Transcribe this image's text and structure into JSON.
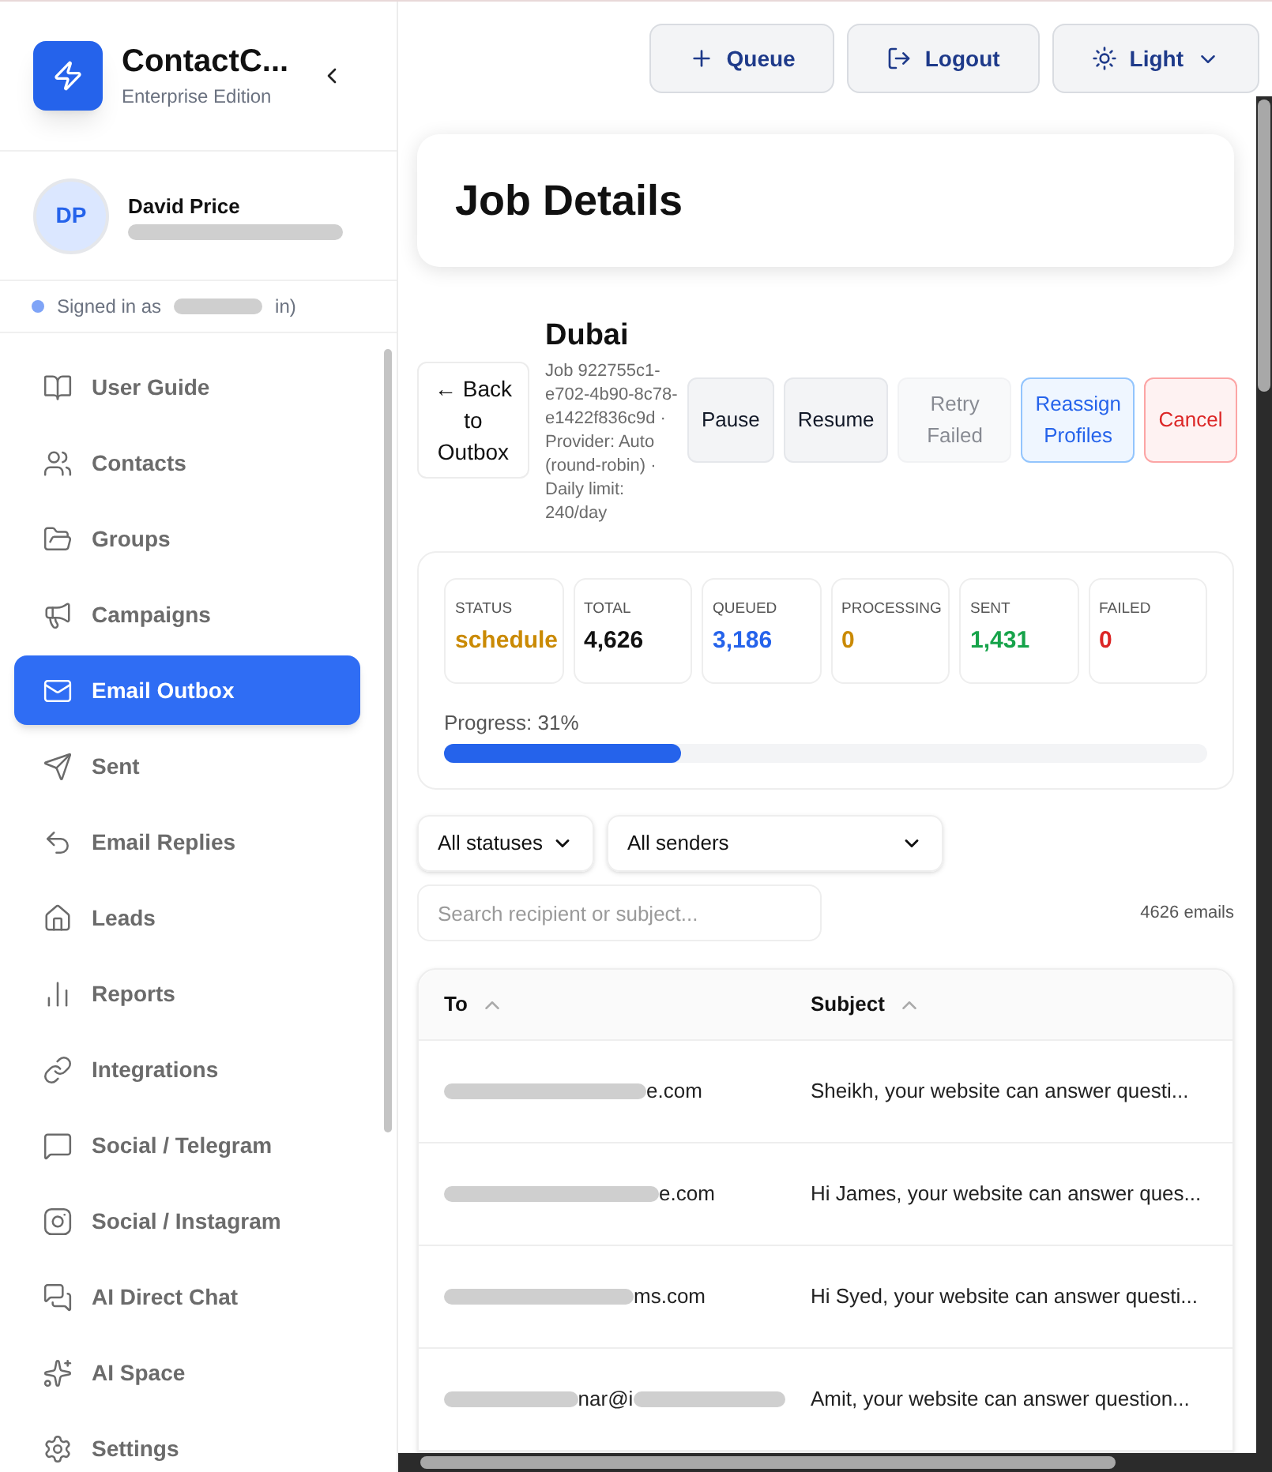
{
  "brand": {
    "name": "ContactC...",
    "edition": "Enterprise Edition"
  },
  "user": {
    "initials": "DP",
    "name": "David Price"
  },
  "signed_in": {
    "prefix": "Signed in as",
    "suffix": "in)"
  },
  "nav": [
    {
      "label": "User Guide",
      "selected": false
    },
    {
      "label": "Contacts",
      "selected": false
    },
    {
      "label": "Groups",
      "selected": false
    },
    {
      "label": "Campaigns",
      "selected": false
    },
    {
      "label": "Email Outbox",
      "selected": true
    },
    {
      "label": "Sent",
      "selected": false
    },
    {
      "label": "Email Replies",
      "selected": false
    },
    {
      "label": "Leads",
      "selected": false
    },
    {
      "label": "Reports",
      "selected": false
    },
    {
      "label": "Integrations",
      "selected": false
    },
    {
      "label": "Social / Telegram",
      "selected": false
    },
    {
      "label": "Social / Instagram",
      "selected": false
    },
    {
      "label": "AI Direct Chat",
      "selected": false
    },
    {
      "label": "AI Space",
      "selected": false
    },
    {
      "label": "Settings",
      "selected": false
    }
  ],
  "topbar": {
    "buttons": [
      {
        "label": "Queue",
        "kind": "queue"
      },
      {
        "label": "Logout",
        "kind": "logout"
      },
      {
        "label": "Light",
        "kind": "theme"
      }
    ]
  },
  "page_title": "Job Details",
  "job": {
    "back": "← Back to Outbox",
    "name": "Dubai",
    "meta": "Job 922755c1-e702-4b90-8c78-e1422f836c9d · Provider: Auto (round-robin) · Daily limit: 240/day",
    "actions": [
      {
        "label": "Pause",
        "kind": "neutral",
        "disabled": false
      },
      {
        "label": "Resume",
        "kind": "neutral",
        "disabled": false
      },
      {
        "label": "Retry Failed",
        "kind": "neutral",
        "disabled": true
      },
      {
        "label": "Reassign Profiles",
        "kind": "primary",
        "disabled": false
      },
      {
        "label": "Cancel",
        "kind": "danger",
        "disabled": false
      }
    ]
  },
  "stats": [
    {
      "label": "STATUS",
      "value": "schedule",
      "color": "#ca8a04"
    },
    {
      "label": "TOTAL",
      "value": "4,626",
      "color": "#111111"
    },
    {
      "label": "QUEUED",
      "value": "3,186",
      "color": "#2563eb"
    },
    {
      "label": "PROCESSING",
      "value": "0",
      "color": "#ca8a04"
    },
    {
      "label": "SENT",
      "value": "1,431",
      "color": "#16a34a"
    },
    {
      "label": "FAILED",
      "value": "0",
      "color": "#dc2626"
    }
  ],
  "progress": {
    "label": "Progress: 31%",
    "level": 0.31
  },
  "filters": {
    "status": "All statuses",
    "sender": "All senders",
    "search_placeholder": "Search recipient or subject...",
    "count": "4626 emails"
  },
  "table": {
    "columns": [
      "To",
      "Subject"
    ],
    "rows": [
      {
        "to": "e.com",
        "subject": "Sheikh, your website can answer questi..."
      },
      {
        "to": "e.com",
        "subject": "Hi James, your website can answer ques..."
      },
      {
        "to": "ms.com",
        "subject": "Hi Syed, your website can answer questi..."
      },
      {
        "to": "nar@i",
        "subject": "Amit, your website can answer question..."
      }
    ]
  }
}
